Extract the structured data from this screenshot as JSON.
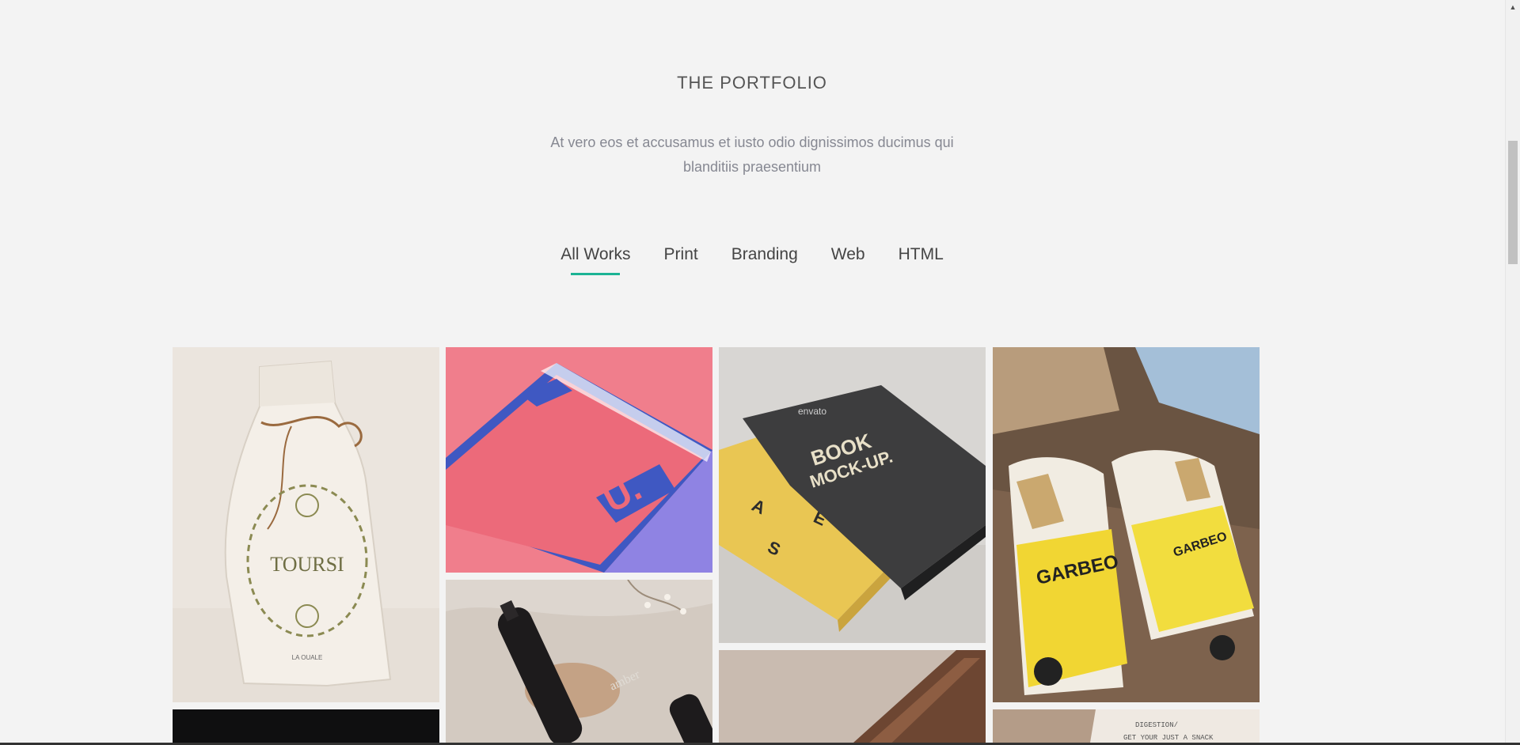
{
  "portfolio": {
    "title": "THE PORTFOLIO",
    "description": "At vero eos et accusamus et iusto odio dignissimos ducimus qui blanditiis praesentium",
    "filters": [
      {
        "label": "All Works",
        "active": true
      },
      {
        "label": "Print",
        "active": false
      },
      {
        "label": "Branding",
        "active": false
      },
      {
        "label": "Web",
        "active": false
      },
      {
        "label": "HTML",
        "active": false
      }
    ],
    "items": [
      {
        "name": "paper-bag-tours",
        "logo_text": "TOURSI"
      },
      {
        "name": "book-cover-mockup",
        "logo_text": "U."
      },
      {
        "name": "book-mockup-slipcase",
        "logo_text": "BOOK MOCK-UP."
      },
      {
        "name": "garbeo-packaging",
        "logo_text": "GARBEO"
      },
      {
        "name": "amber-bottles",
        "logo_text": "amber"
      },
      {
        "name": "dark-item",
        "logo_text": ""
      },
      {
        "name": "wood-item",
        "logo_text": ""
      },
      {
        "name": "notes-item",
        "logo_text": ""
      }
    ]
  },
  "colors": {
    "accent": "#1bb394",
    "background": "#f3f3f3"
  }
}
